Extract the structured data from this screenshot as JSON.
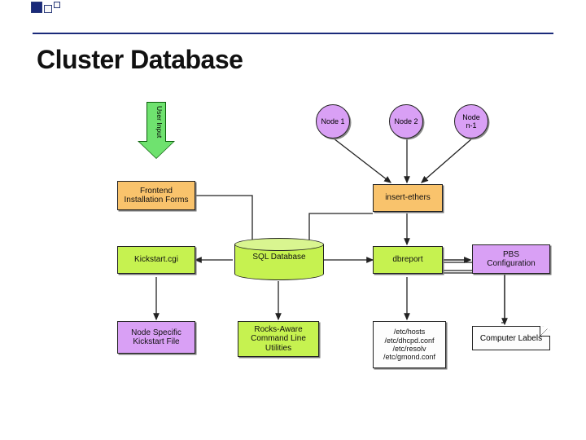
{
  "title": "Cluster Database",
  "input_arrow_label": "User Input",
  "nodes": {
    "node1": "Node 1",
    "node2": "Node 2",
    "noden1": "Node\nn-1"
  },
  "boxes": {
    "frontend_forms": "Frontend\nInstallation Forms",
    "kickstart_cgi": "Kickstart.cgi",
    "node_specific_ks": "Node Specific\nKickstart File",
    "sql_db": "SQL Database",
    "rocks_utils": "Rocks-Aware\nCommand Line\nUtilities",
    "insert_ethers": "insert-ethers",
    "dbreport": "dbreport",
    "etc_files": "/etc/hosts\n/etc/dhcpd.conf\n/etc/resolv\n/etc/gmond.conf",
    "pbs_config": "PBS\nConfiguration",
    "computer_labels": "Computer Labels"
  }
}
